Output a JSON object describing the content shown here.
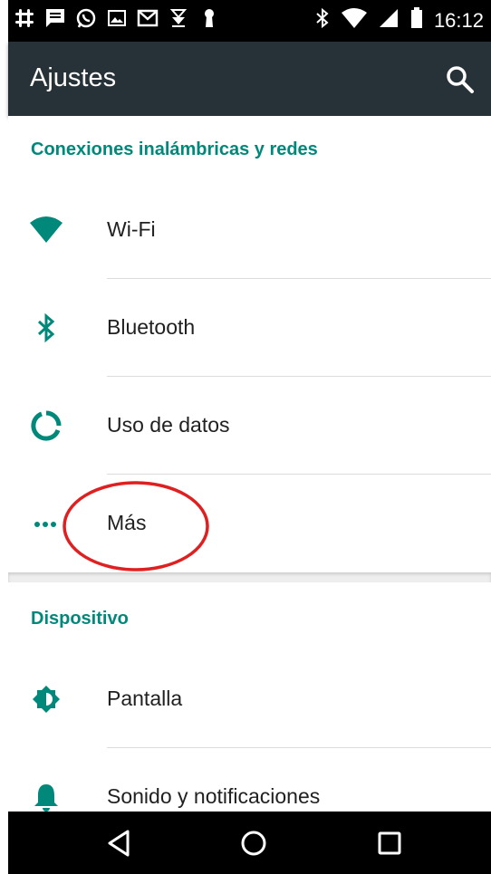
{
  "status_bar": {
    "time": "16:12",
    "left_icons": [
      "slack-icon",
      "message-icon",
      "whatsapp-icon",
      "gallery-icon",
      "gmail-icon",
      "download-icon",
      "keyhole-icon"
    ],
    "right_icons": [
      "bluetooth-icon",
      "wifi-icon",
      "signal-icon",
      "battery-icon"
    ]
  },
  "app_bar": {
    "title": "Ajustes",
    "search_icon": "search-icon"
  },
  "sections": [
    {
      "header": "Conexiones inalámbricas y redes",
      "items": [
        {
          "label": "Wi-Fi",
          "icon": "wifi-icon"
        },
        {
          "label": "Bluetooth",
          "icon": "bluetooth-icon"
        },
        {
          "label": "Uso de datos",
          "icon": "data-usage-icon"
        },
        {
          "label": "Más",
          "icon": "more-dots-icon"
        }
      ]
    },
    {
      "header": "Dispositivo",
      "items": [
        {
          "label": "Pantalla",
          "icon": "brightness-icon"
        },
        {
          "label": "Sonido y notificaciones",
          "icon": "bell-icon"
        }
      ]
    }
  ],
  "nav_bar": {
    "buttons": [
      "back-icon",
      "home-icon",
      "recents-icon"
    ]
  },
  "colors": {
    "accent": "#00897b",
    "app_bar": "#263238",
    "annotation": "#e02020"
  }
}
